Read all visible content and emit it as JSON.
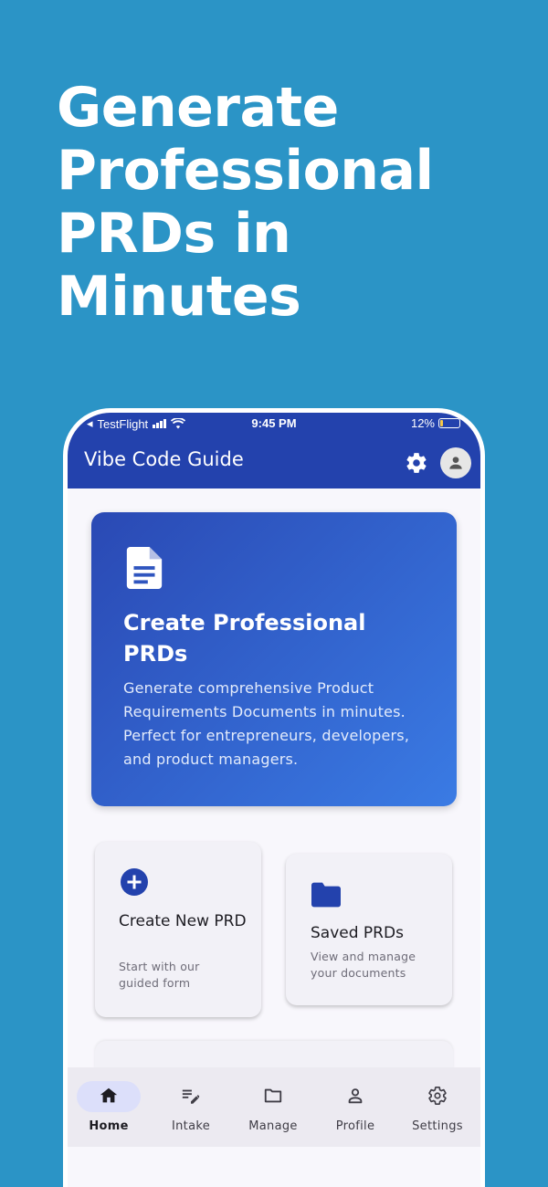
{
  "headline": "Generate Professional PRDs in Minutes",
  "status_bar": {
    "carrier": "TestFlight",
    "time": "9:45 PM",
    "battery": "12%"
  },
  "app_bar": {
    "title": "Vibe Code Guide",
    "settings_icon": "gear-icon",
    "avatar_icon": "person-icon"
  },
  "hero": {
    "icon": "document-icon",
    "title": "Create Professional PRDs",
    "description": "Generate comprehensive Product Requirements Documents in minutes. Perfect for entrepreneurs, developers, and product managers."
  },
  "cards": {
    "create": {
      "icon": "add-circle-icon",
      "title": "Create New PRD",
      "subtitle": "Start with our guided form"
    },
    "saved": {
      "icon": "folder-icon",
      "title": "Saved PRDs",
      "subtitle": "View and manage your documents"
    }
  },
  "nav": {
    "items": [
      {
        "label": "Home",
        "icon": "home-icon",
        "active": true
      },
      {
        "label": "Intake",
        "icon": "edit-list-icon",
        "active": false
      },
      {
        "label": "Manage",
        "icon": "folder-outline-icon",
        "active": false
      },
      {
        "label": "Profile",
        "icon": "person-outline-icon",
        "active": false
      },
      {
        "label": "Settings",
        "icon": "gear-outline-icon",
        "active": false
      }
    ]
  },
  "colors": {
    "background": "#2b94c6",
    "primary": "#2342ad",
    "hero_gradient_start": "#2a49b4",
    "hero_gradient_end": "#3a7be4",
    "nav_active_pill": "#dcdffa"
  }
}
